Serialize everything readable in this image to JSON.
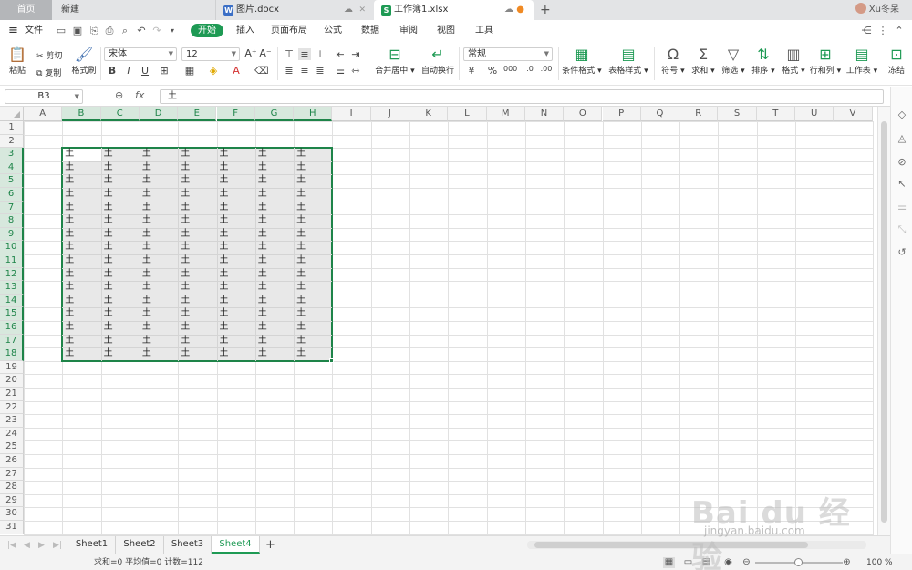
{
  "tabs": {
    "home": "首页",
    "new": "新建",
    "doc": "图片.docx",
    "xls": "工作簿1.xlsx",
    "user": "Xu冬呆"
  },
  "menu": {
    "file": "文件",
    "start": "开始",
    "items": [
      "插入",
      "页面布局",
      "公式",
      "数据",
      "审阅",
      "视图",
      "工具"
    ]
  },
  "ribbon": {
    "paste": "粘贴",
    "cut": "剪切",
    "copy": "复制",
    "format_painter": "格式刷",
    "font_name": "宋体",
    "font_size": "12",
    "merge_center": "合并居中",
    "wrap_text": "自动换行",
    "number_format": "常规",
    "conditional_format": "条件格式",
    "table_style": "表格样式",
    "symbol": "符号",
    "sum": "求和",
    "filter": "筛选",
    "sort": "排序",
    "format": "格式",
    "row_col": "行和列",
    "worksheet": "工作表",
    "freeze": "冻结"
  },
  "formula_bar": {
    "cell_ref": "B3",
    "fx": "fx",
    "content": "土"
  },
  "grid": {
    "columns": [
      "A",
      "B",
      "C",
      "D",
      "E",
      "F",
      "G",
      "H",
      "I",
      "J",
      "K",
      "L",
      "M",
      "N",
      "O",
      "P",
      "Q",
      "R",
      "S",
      "T",
      "U",
      "V"
    ],
    "rows": [
      "1",
      "2",
      "3",
      "4",
      "5",
      "6",
      "7",
      "8",
      "9",
      "10",
      "11",
      "12",
      "13",
      "14",
      "15",
      "16",
      "17",
      "18",
      "19",
      "20",
      "21",
      "22",
      "23",
      "24",
      "25",
      "26",
      "27",
      "28",
      "29",
      "30",
      "31"
    ],
    "selected_columns": [
      "B",
      "C",
      "D",
      "E",
      "F",
      "G",
      "H"
    ],
    "selected_rows": [
      "3",
      "4",
      "5",
      "6",
      "7",
      "8",
      "9",
      "10",
      "11",
      "12",
      "13",
      "14",
      "15",
      "16",
      "17",
      "18"
    ],
    "cell_value": "土"
  },
  "sheets": {
    "tabs": [
      "Sheet1",
      "Sheet2",
      "Sheet3",
      "Sheet4"
    ],
    "active": "Sheet4",
    "add": "+"
  },
  "status": {
    "summary": "求和=0  平均值=0  计数=112",
    "zoom": "100 %"
  },
  "watermark": {
    "main": "Bai du 经验",
    "sub": "jingyan.baidu.com"
  },
  "colors": {
    "accent": "#1e9a54",
    "selection_border": "#1e8449",
    "selection_fill": "#e8e8e8"
  }
}
